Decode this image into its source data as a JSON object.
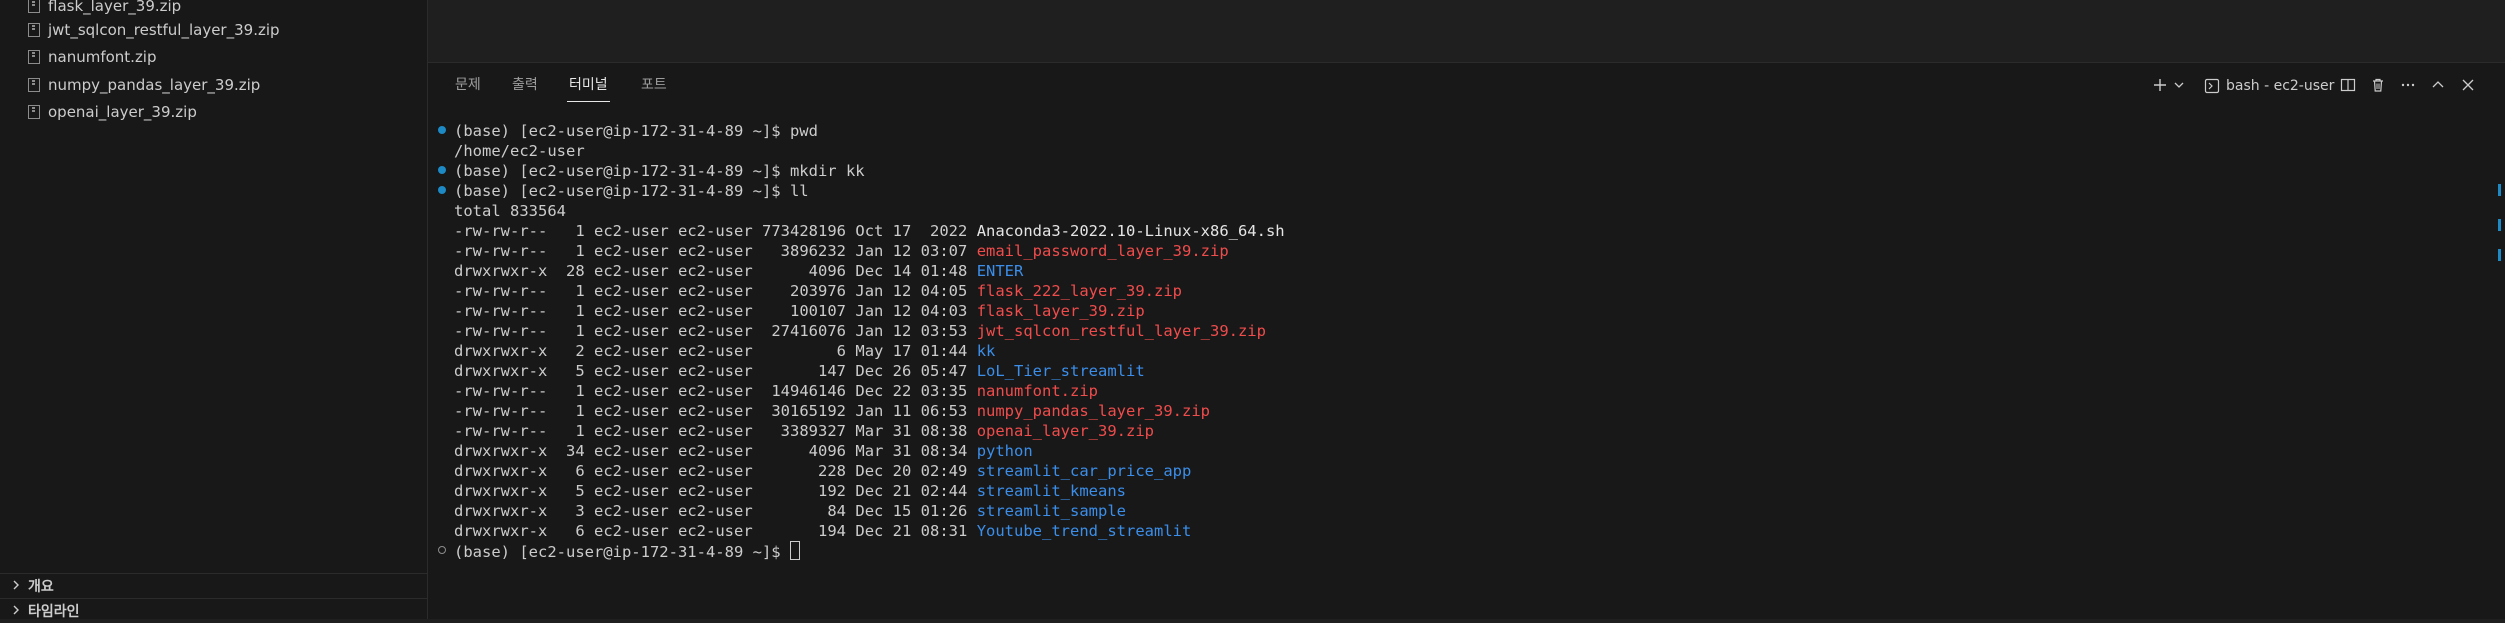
{
  "sidebar": {
    "files": [
      {
        "name": "flask_layer_39.zip"
      },
      {
        "name": "jwt_sqlcon_restful_layer_39.zip"
      },
      {
        "name": "nanumfont.zip"
      },
      {
        "name": "numpy_pandas_layer_39.zip"
      },
      {
        "name": "openai_layer_39.zip"
      }
    ],
    "sections": [
      {
        "label": "개요"
      },
      {
        "label": "타임라인"
      }
    ]
  },
  "panel": {
    "tabs": [
      {
        "label": "문제"
      },
      {
        "label": "출력"
      },
      {
        "label": "터미널"
      },
      {
        "label": "포트"
      }
    ],
    "active_tab": "터미널",
    "terminal_label": "bash - ec2-user",
    "icons": [
      "plus-icon",
      "chevron-down-icon",
      "terminal-icon",
      "split-icon",
      "trash-icon",
      "more-icon",
      "chevron-up-icon",
      "close-icon"
    ]
  },
  "terminal": {
    "prompt": "(base) [ec2-user@ip-172-31-4-89 ~]$ ",
    "commands": {
      "pwd": "pwd",
      "pwd_output": "/home/ec2-user",
      "mkdir": "mkdir kk",
      "ll": "ll",
      "total": "total 833564"
    },
    "listing": [
      {
        "perms": "-rw-rw-r-- ",
        "links": " 1",
        "owner": "ec2-user",
        "group": "ec2-user",
        "size": "773428196",
        "date": "Oct 17  2022",
        "name": "Anaconda3-2022.10-Linux-x86_64.sh",
        "color": "white"
      },
      {
        "perms": "-rw-rw-r-- ",
        "links": " 1",
        "owner": "ec2-user",
        "group": "ec2-user",
        "size": "  3896232",
        "date": "Jan 12 03:07",
        "name": "email_password_layer_39.zip",
        "color": "red"
      },
      {
        "perms": "drwxrwxr-x ",
        "links": "28",
        "owner": "ec2-user",
        "group": "ec2-user",
        "size": "     4096",
        "date": "Dec 14 01:48",
        "name": "ENTER",
        "color": "blue"
      },
      {
        "perms": "-rw-rw-r-- ",
        "links": " 1",
        "owner": "ec2-user",
        "group": "ec2-user",
        "size": "   203976",
        "date": "Jan 12 04:05",
        "name": "flask_222_layer_39.zip",
        "color": "red"
      },
      {
        "perms": "-rw-rw-r-- ",
        "links": " 1",
        "owner": "ec2-user",
        "group": "ec2-user",
        "size": "   100107",
        "date": "Jan 12 04:03",
        "name": "flask_layer_39.zip",
        "color": "red"
      },
      {
        "perms": "-rw-rw-r-- ",
        "links": " 1",
        "owner": "ec2-user",
        "group": "ec2-user",
        "size": " 27416076",
        "date": "Jan 12 03:53",
        "name": "jwt_sqlcon_restful_layer_39.zip",
        "color": "red"
      },
      {
        "perms": "drwxrwxr-x ",
        "links": " 2",
        "owner": "ec2-user",
        "group": "ec2-user",
        "size": "        6",
        "date": "May 17 01:44",
        "name": "kk",
        "color": "blue"
      },
      {
        "perms": "drwxrwxr-x ",
        "links": " 5",
        "owner": "ec2-user",
        "group": "ec2-user",
        "size": "      147",
        "date": "Dec 26 05:47",
        "name": "LoL_Tier_streamlit",
        "color": "blue"
      },
      {
        "perms": "-rw-rw-r-- ",
        "links": " 1",
        "owner": "ec2-user",
        "group": "ec2-user",
        "size": " 14946146",
        "date": "Dec 22 03:35",
        "name": "nanumfont.zip",
        "color": "red"
      },
      {
        "perms": "-rw-rw-r-- ",
        "links": " 1",
        "owner": "ec2-user",
        "group": "ec2-user",
        "size": " 30165192",
        "date": "Jan 11 06:53",
        "name": "numpy_pandas_layer_39.zip",
        "color": "red"
      },
      {
        "perms": "-rw-rw-r-- ",
        "links": " 1",
        "owner": "ec2-user",
        "group": "ec2-user",
        "size": "  3389327",
        "date": "Mar 31 08:38",
        "name": "openai_layer_39.zip",
        "color": "red"
      },
      {
        "perms": "drwxrwxr-x ",
        "links": "34",
        "owner": "ec2-user",
        "group": "ec2-user",
        "size": "     4096",
        "date": "Mar 31 08:34",
        "name": "python",
        "color": "blue"
      },
      {
        "perms": "drwxrwxr-x ",
        "links": " 6",
        "owner": "ec2-user",
        "group": "ec2-user",
        "size": "      228",
        "date": "Dec 20 02:49",
        "name": "streamlit_car_price_app",
        "color": "blue"
      },
      {
        "perms": "drwxrwxr-x ",
        "links": " 5",
        "owner": "ec2-user",
        "group": "ec2-user",
        "size": "      192",
        "date": "Dec 21 02:44",
        "name": "streamlit_kmeans",
        "color": "blue"
      },
      {
        "perms": "drwxrwxr-x ",
        "links": " 3",
        "owner": "ec2-user",
        "group": "ec2-user",
        "size": "       84",
        "date": "Dec 15 01:26",
        "name": "streamlit_sample",
        "color": "blue"
      },
      {
        "perms": "drwxrwxr-x ",
        "links": " 6",
        "owner": "ec2-user",
        "group": "ec2-user",
        "size": "      194",
        "date": "Dec 21 08:31",
        "name": "Youtube_trend_streamlit",
        "color": "blue"
      }
    ],
    "colors": {
      "red": "#f14c4c",
      "blue": "#3b8eea",
      "white": "#e5e5e5",
      "decoration": "#1d89c5"
    }
  }
}
